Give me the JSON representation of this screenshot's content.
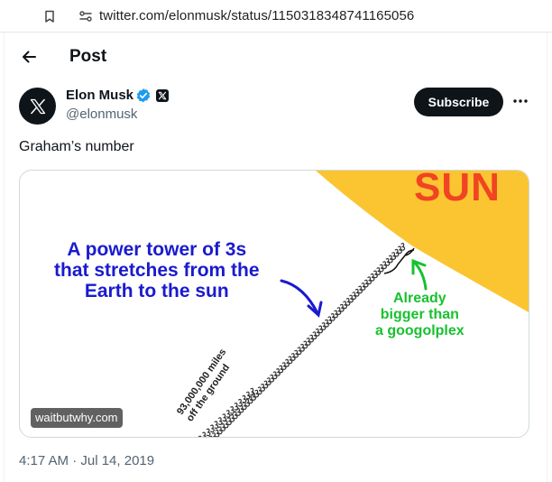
{
  "browser": {
    "url": "twitter.com/elonmusk/status/1150318348741165056",
    "icons": {
      "bookmark": "bookmark-icon",
      "site_settings": "site-settings-icon"
    }
  },
  "header": {
    "title": "Post",
    "back_icon": "arrow-left-icon"
  },
  "author": {
    "name": "Elon Musk",
    "handle": "@elonmusk",
    "verified_icon": "verified-badge-icon",
    "affiliate_icon": "x-logo-icon",
    "avatar_icon": "x-logo-icon",
    "verified_color": "#1d9bf0"
  },
  "actions": {
    "subscribe_label": "Subscribe",
    "more_icon": "more-horizontal-icon"
  },
  "tweet": {
    "text": "Graham’s number",
    "timestamp": "4:17 AM · Jul 14, 2019"
  },
  "media": {
    "sun_label": "SUN",
    "tower_caption": [
      "A power tower of 3s",
      "that stretches from the",
      "Earth to the sun"
    ],
    "googol_caption": [
      "Already",
      "bigger than",
      "a googolplex"
    ],
    "miles_label": [
      "93,000,000 miles",
      "off the ground"
    ],
    "source": "waitbutwhy.com",
    "colors": {
      "sun": "#fbc531",
      "sun_text": "#f04423",
      "tower_caption": "#1a1acf",
      "googol_caption": "#17c12e"
    }
  },
  "colors": {
    "text_primary": "#0f1419",
    "text_secondary": "#536471",
    "button_bg": "#0f1419",
    "border": "#cfd9de"
  }
}
